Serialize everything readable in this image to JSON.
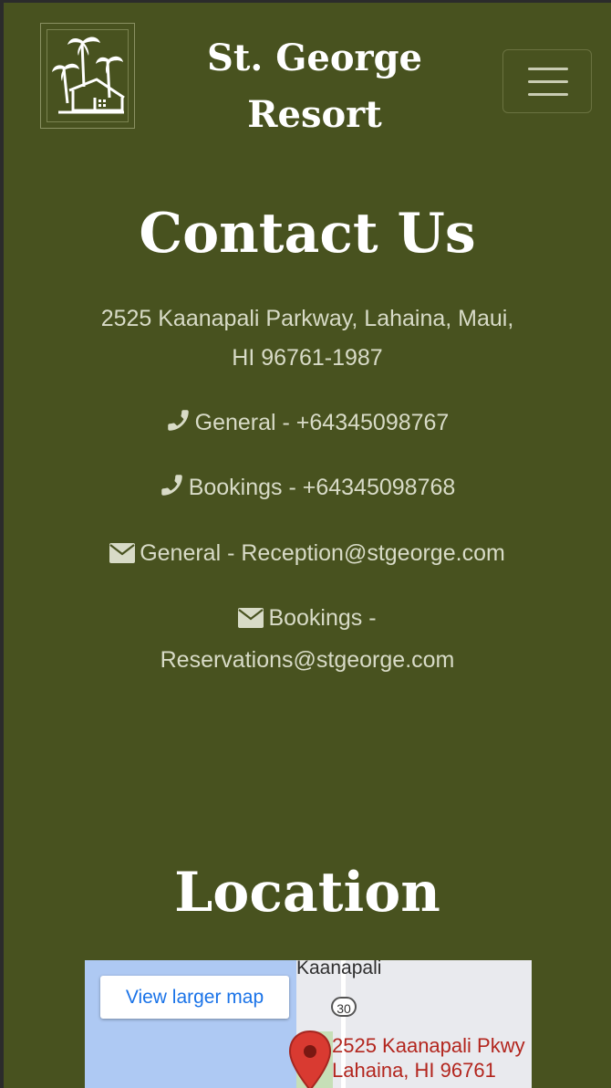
{
  "header": {
    "brand_line1": "St. George",
    "brand_line2": "Resort",
    "logo_icon": "palm-house-logo",
    "menu_icon": "hamburger-icon"
  },
  "contact": {
    "title": "Contact Us",
    "address_line1": "2525 Kaanapali Parkway, Lahaina, Maui,",
    "address_line2": "HI 96761-1987",
    "phones": [
      {
        "text": "General - +64345098767",
        "icon": "phone-icon"
      },
      {
        "text": "Bookings - +64345098768",
        "icon": "phone-icon"
      }
    ],
    "emails": [
      {
        "label": "General - ",
        "address": "Reception@stgeorge.com",
        "icon": "envelope-icon"
      },
      {
        "label": "Bookings -",
        "address": "Reservations@stgeorge.com",
        "icon": "envelope-icon"
      }
    ]
  },
  "location": {
    "title": "Location",
    "map": {
      "button_label": "View larger map",
      "place_label": "Kaanapali",
      "route_number": "30",
      "address_line1": "2525 Kaanapali Pkwy",
      "address_line2": "Lahaina, HI 96761"
    }
  },
  "colors": {
    "background": "#48521f",
    "text_light": "#d8dbc7",
    "heading": "#ffffff",
    "map_link": "#1a73e8",
    "map_pin": "#d93a31"
  }
}
